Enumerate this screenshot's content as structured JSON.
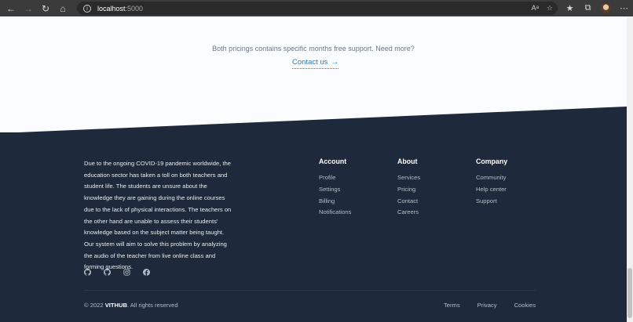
{
  "browser": {
    "url_host": "localhost",
    "url_port": ":5000"
  },
  "pricing": {
    "support_text": "Both pricings contains specific months free support. Need more?",
    "contact_label": "Contact us"
  },
  "footer": {
    "about_text": "Due to the ongoing COVID-19 pandemic worldwide, the education sector has taken a toll on both teachers and student life. The students are unsure about the knowledge they are gaining during the online courses due to the lack of physical interactions. The teachers on the other hand are unable to assess their students' knowledge based on the subject matter being taught. Our system will aim to solve this problem by analyzing the audio of the teacher from live online class and forming questions.",
    "columns": [
      {
        "title": "Account",
        "links": [
          "Profile",
          "Settings",
          "Billing",
          "Notifications"
        ]
      },
      {
        "title": "About",
        "links": [
          "Services",
          "Pricing",
          "Contact",
          "Careers"
        ]
      },
      {
        "title": "Company",
        "links": [
          "Community",
          "Help center",
          "Support"
        ]
      }
    ],
    "socials": [
      "github-icon",
      "github-icon",
      "instagram-icon",
      "facebook-icon"
    ],
    "copyright_prefix": "© 2022",
    "brand": "VITHUB",
    "copyright_suffix": ". All rights reserved",
    "legal": [
      "Terms",
      "Privacy",
      "Cookies"
    ]
  },
  "colors": {
    "footer_bg": "#1e2a3b",
    "light_bg": "#fbfcfe",
    "link_accent": "#1e7fbd"
  }
}
